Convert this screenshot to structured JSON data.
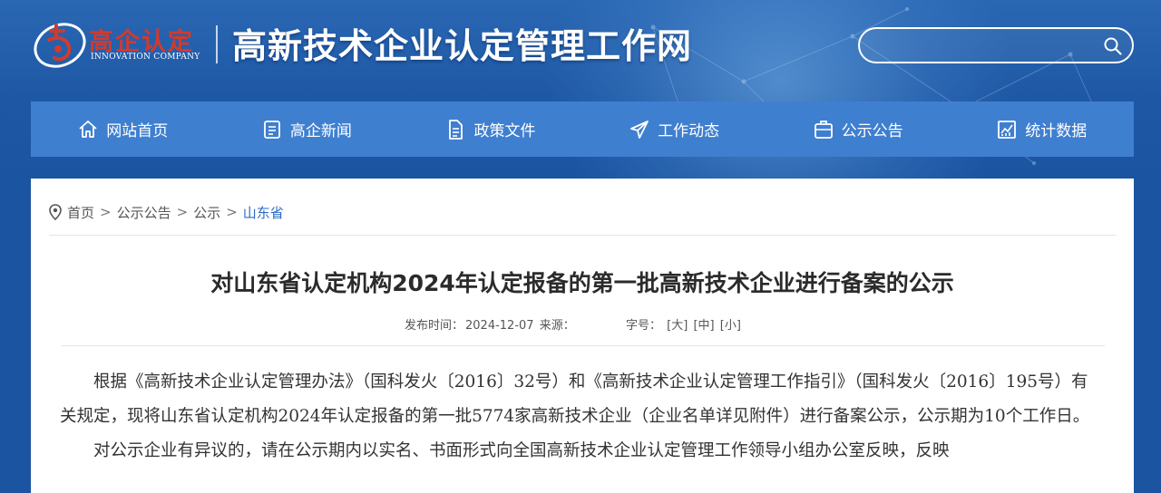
{
  "header": {
    "logo_title": "高企认定",
    "logo_subtitle": "INNOVATION COMPANY",
    "site_title": "高新技术企业认定管理工作网",
    "search_placeholder": ""
  },
  "nav": {
    "items": [
      {
        "label": "网站首页",
        "icon": "home-icon"
      },
      {
        "label": "高企新闻",
        "icon": "news-icon"
      },
      {
        "label": "政策文件",
        "icon": "document-icon"
      },
      {
        "label": "工作动态",
        "icon": "send-icon"
      },
      {
        "label": "公示公告",
        "icon": "notice-icon"
      },
      {
        "label": "统计数据",
        "icon": "chart-icon"
      }
    ]
  },
  "breadcrumb": {
    "items": [
      "首页",
      "公示公告",
      "公示",
      "山东省"
    ],
    "separator": ">"
  },
  "article": {
    "title": "对山东省认定机构2024年认定报备的第一批高新技术企业进行备案的公示",
    "published_label": "发布时间：",
    "published_date": "2024-12-07",
    "source_label": "来源：",
    "source_value": "",
    "font_size_label": "字号：",
    "font_size_large": "[大]",
    "font_size_medium": "[中]",
    "font_size_small": "[小]",
    "paragraphs": [
      "根据《高新技术企业认定管理办法》（国科发火〔2016〕32号）和《高新技术企业认定管理工作指引》（国科发火〔2016〕195号）有关规定，现将山东省认定机构2024年认定报备的第一批5774家高新技术企业（企业名单详见附件）进行备案公示，公示期为10个工作日。",
      "对公示企业有异议的，请在公示期内以实名、书面形式向全国高新技术企业认定管理工作领导小组办公室反映，反映"
    ]
  },
  "colors": {
    "header_bg": "#1e58a5",
    "nav_bg": "#3f7fd0",
    "logo_red": "#d23a2c",
    "breadcrumb_current": "#2a6bc3"
  }
}
